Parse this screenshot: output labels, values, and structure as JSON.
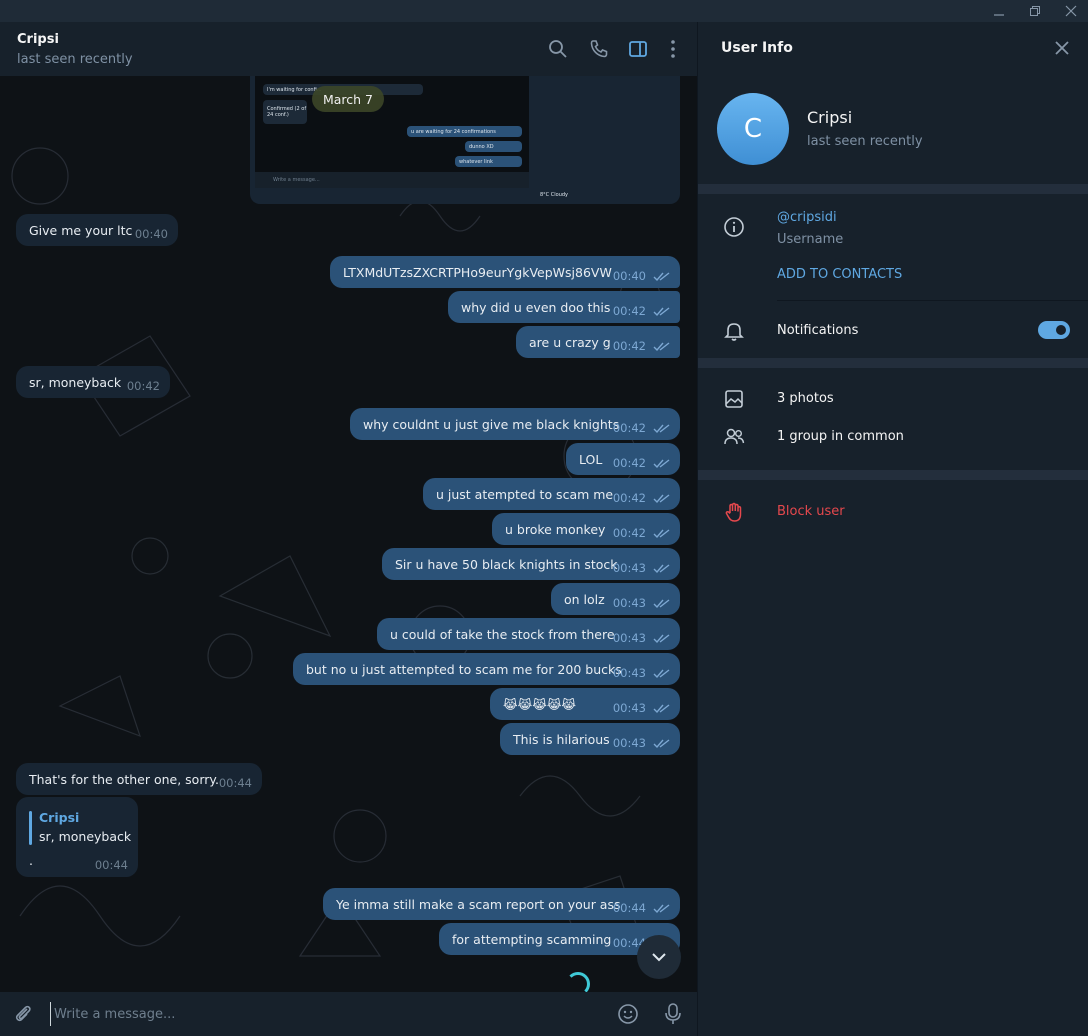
{
  "chat": {
    "name": "Cripsi",
    "status": "last seen recently",
    "date_label": "March 7",
    "composer_placeholder": "Write a message...",
    "messages": [
      {
        "dir": "in",
        "text": "Give me your ltc",
        "time": "00:40"
      },
      {
        "dir": "out",
        "text": "LTXMdUTzsZXCRTPHo9eurYgkVepWsj86VW",
        "time": "00:40"
      },
      {
        "dir": "out",
        "text": "why did u even doo this",
        "time": "00:42"
      },
      {
        "dir": "out",
        "text": "are u crazy g",
        "time": "00:42"
      },
      {
        "dir": "in",
        "text": "sr, moneyback",
        "time": "00:42"
      },
      {
        "dir": "out",
        "text": "why couldnt u just give me black knights",
        "time": "00:42"
      },
      {
        "dir": "out",
        "text": "LOL",
        "time": "00:42"
      },
      {
        "dir": "out",
        "text": "u just atempted to scam me",
        "time": "00:42"
      },
      {
        "dir": "out",
        "text": "u broke monkey",
        "time": "00:42"
      },
      {
        "dir": "out",
        "text": "Sir u have 50  black knights in stock",
        "time": "00:43"
      },
      {
        "dir": "out",
        "text": "on lolz",
        "time": "00:43"
      },
      {
        "dir": "out",
        "text": "u could of take the stock from there",
        "time": "00:43"
      },
      {
        "dir": "out",
        "text": "but no u just attempted to scam me for 200 bucks",
        "time": "00:43"
      },
      {
        "dir": "out",
        "text": "😹😹😹😹😹",
        "time": "00:43"
      },
      {
        "dir": "out",
        "text": "This is hilarious",
        "time": "00:43"
      },
      {
        "dir": "in",
        "text": "That's for the other one, sorry.",
        "time": "00:44"
      },
      {
        "dir": "out",
        "text": "Ye imma still make a scam report on your ass",
        "time": "00:44"
      },
      {
        "dir": "out",
        "text": "for attempting scamming",
        "time": "00:44"
      }
    ],
    "reply": {
      "author": "Cripsi",
      "quote": "sr, moneyback",
      "text": ".",
      "time": "00:44"
    },
    "screenshot_preview": {
      "lines": [
        "I'm waiting for confi...",
        "Confirmed (2 of 24 conf.)",
        "u are waiting for 24 confirmations",
        "dunno XD",
        "whatever link"
      ],
      "composer": "Write a message...",
      "taskbar": "8°C  Cloudy"
    }
  },
  "info": {
    "title": "User Info",
    "name": "Cripsi",
    "status": "last seen recently",
    "avatar_letter": "C",
    "username": "@cripsidi",
    "username_label": "Username",
    "add_contacts": "ADD TO CONTACTS",
    "notifications": "Notifications",
    "photos": "3 photos",
    "groups": "1 group in common",
    "block": "Block user"
  },
  "colors": {
    "accent": "#5fa8e2",
    "outgoing_bubble": "#2b5278",
    "incoming_bubble": "#182533",
    "danger": "#e5484d"
  }
}
